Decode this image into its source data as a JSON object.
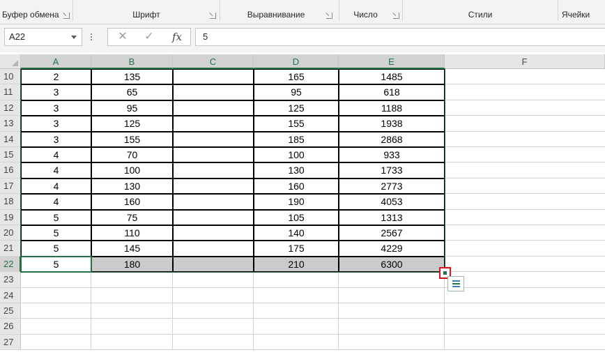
{
  "ribbon": {
    "groups": [
      {
        "label": "Буфер обмена"
      },
      {
        "label": "Шрифт"
      },
      {
        "label": "Выравнивание"
      },
      {
        "label": "Число"
      },
      {
        "label": "Стили"
      },
      {
        "label": "Ячейки"
      }
    ]
  },
  "formula_bar": {
    "name_box": "A22",
    "cancel_glyph": "✕",
    "enter_glyph": "✓",
    "fx_label": "fx",
    "value": "5"
  },
  "grid": {
    "columns": [
      "A",
      "B",
      "C",
      "D",
      "E",
      "F"
    ],
    "selected_row": "22",
    "rows": [
      {
        "num": "10",
        "a": "2",
        "b": "135",
        "d": "165",
        "e": "1485"
      },
      {
        "num": "11",
        "a": "3",
        "b": "65",
        "d": "95",
        "e": "618"
      },
      {
        "num": "12",
        "a": "3",
        "b": "95",
        "d": "125",
        "e": "1188"
      },
      {
        "num": "13",
        "a": "3",
        "b": "125",
        "d": "155",
        "e": "1938"
      },
      {
        "num": "14",
        "a": "3",
        "b": "155",
        "d": "185",
        "e": "2868"
      },
      {
        "num": "15",
        "a": "4",
        "b": "70",
        "d": "100",
        "e": "933"
      },
      {
        "num": "16",
        "a": "4",
        "b": "100",
        "d": "130",
        "e": "1733"
      },
      {
        "num": "17",
        "a": "4",
        "b": "130",
        "d": "160",
        "e": "2773"
      },
      {
        "num": "18",
        "a": "4",
        "b": "160",
        "d": "190",
        "e": "4053"
      },
      {
        "num": "19",
        "a": "5",
        "b": "75",
        "d": "105",
        "e": "1313"
      },
      {
        "num": "20",
        "a": "5",
        "b": "110",
        "d": "140",
        "e": "2567"
      },
      {
        "num": "21",
        "a": "5",
        "b": "145",
        "d": "175",
        "e": "4229"
      },
      {
        "num": "22",
        "a": "5",
        "b": "180",
        "d": "210",
        "e": "6300"
      },
      {
        "num": "23",
        "a": "",
        "b": "",
        "d": "",
        "e": ""
      },
      {
        "num": "24",
        "a": "",
        "b": "",
        "d": "",
        "e": ""
      },
      {
        "num": "25",
        "a": "",
        "b": "",
        "d": "",
        "e": ""
      },
      {
        "num": "26",
        "a": "",
        "b": "",
        "d": "",
        "e": ""
      },
      {
        "num": "27",
        "a": "",
        "b": "",
        "d": "",
        "e": ""
      }
    ]
  },
  "colors": {
    "accent": "#217346",
    "highlight": "#e0101b"
  }
}
